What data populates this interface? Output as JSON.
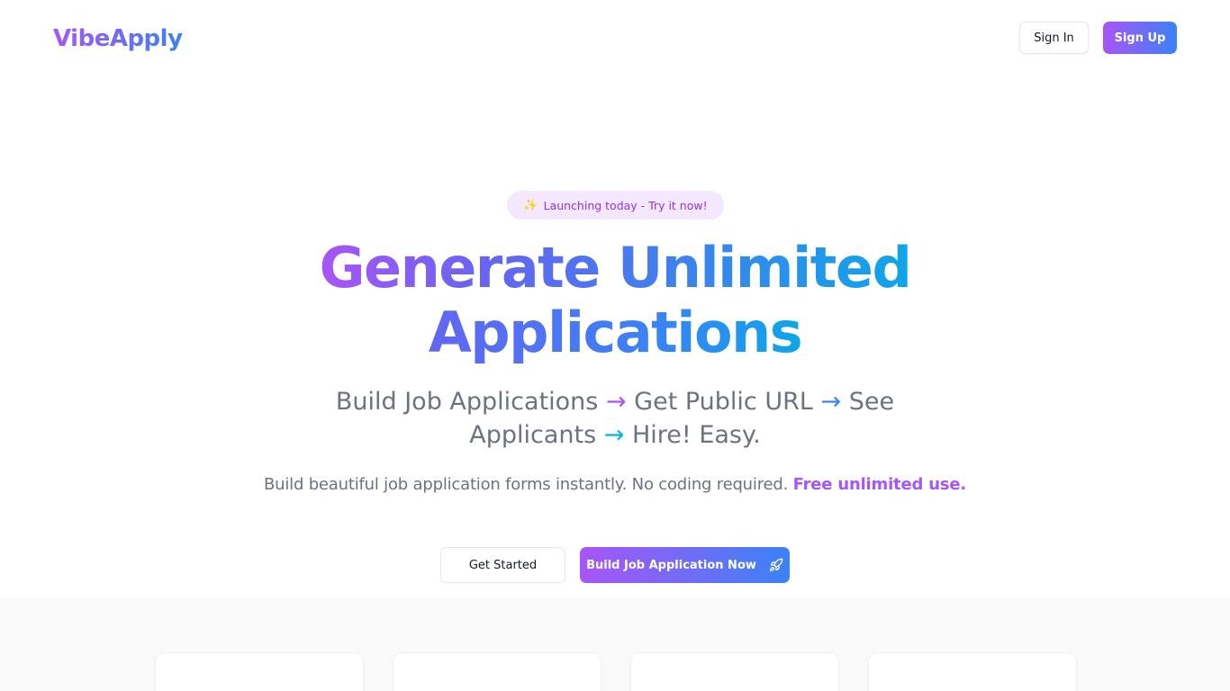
{
  "header": {
    "logo": "VibeApply",
    "sign_in_label": "Sign In",
    "sign_up_label": "Sign Up"
  },
  "hero": {
    "badge_icon": "sparkles-icon",
    "badge_text": "Launching today - Try it now!",
    "headline_line1": "Generate Unlimited",
    "headline_line2": "Applications",
    "subhead": {
      "step1": "Build Job Applications",
      "step2": "Get Public URL",
      "step3a": "See",
      "step3b": "Applicants",
      "step4": "Hire! Easy.",
      "arrow": "→"
    },
    "description": "Build beautiful job application forms instantly. No coding required.",
    "description_highlight": "Free unlimited use.",
    "get_started_label": "Get Started",
    "build_now_label": "Build Job Application Now",
    "build_now_icon": "rocket-icon"
  },
  "colors": {
    "brand_purple": "#a855f7",
    "brand_blue": "#3b82f6",
    "brand_cyan": "#0ea5e9",
    "badge_bg": "#f3e8ff",
    "text_muted": "#6b7280"
  }
}
